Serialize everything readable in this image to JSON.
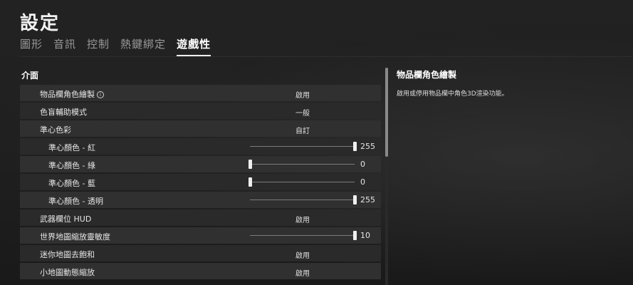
{
  "header": {
    "title": "設定",
    "tabs": [
      {
        "label": "圖形",
        "active": false
      },
      {
        "label": "音訊",
        "active": false
      },
      {
        "label": "控制",
        "active": false
      },
      {
        "label": "熱鍵綁定",
        "active": false
      },
      {
        "label": "遊戲性",
        "active": true
      }
    ]
  },
  "section": {
    "title": "介面",
    "rows": [
      {
        "label": "物品欄角色繪製",
        "value": "啟用",
        "info": "i"
      },
      {
        "label": "色盲輔助模式",
        "value": "一般"
      },
      {
        "label": "準心色彩",
        "value": "自訂"
      },
      {
        "label": "準心顏色 - 紅",
        "slider": 255,
        "slider_max": 255
      },
      {
        "label": "準心顏色 - 綠",
        "slider": 0,
        "slider_max": 255
      },
      {
        "label": "準心顏色 - 藍",
        "slider": 0,
        "slider_max": 255
      },
      {
        "label": "準心顏色 - 透明",
        "slider": 255,
        "slider_max": 255
      },
      {
        "label": "武器欄位 HUD",
        "value": "啟用"
      },
      {
        "label": "世界地圖縮放靈敏度",
        "slider": 10,
        "slider_max": 10
      },
      {
        "label": "迷你地圖去飽和",
        "value": "啟用"
      },
      {
        "label": "小地圖動態縮放",
        "value": "啟用"
      }
    ]
  },
  "description": {
    "title": "物品欄角色繪製",
    "text": "啟用或停用物品欄中角色3D渲染功能。"
  },
  "colors": {
    "background": "#1c1c1c",
    "row": "#303030",
    "accent": "#ffffff"
  }
}
